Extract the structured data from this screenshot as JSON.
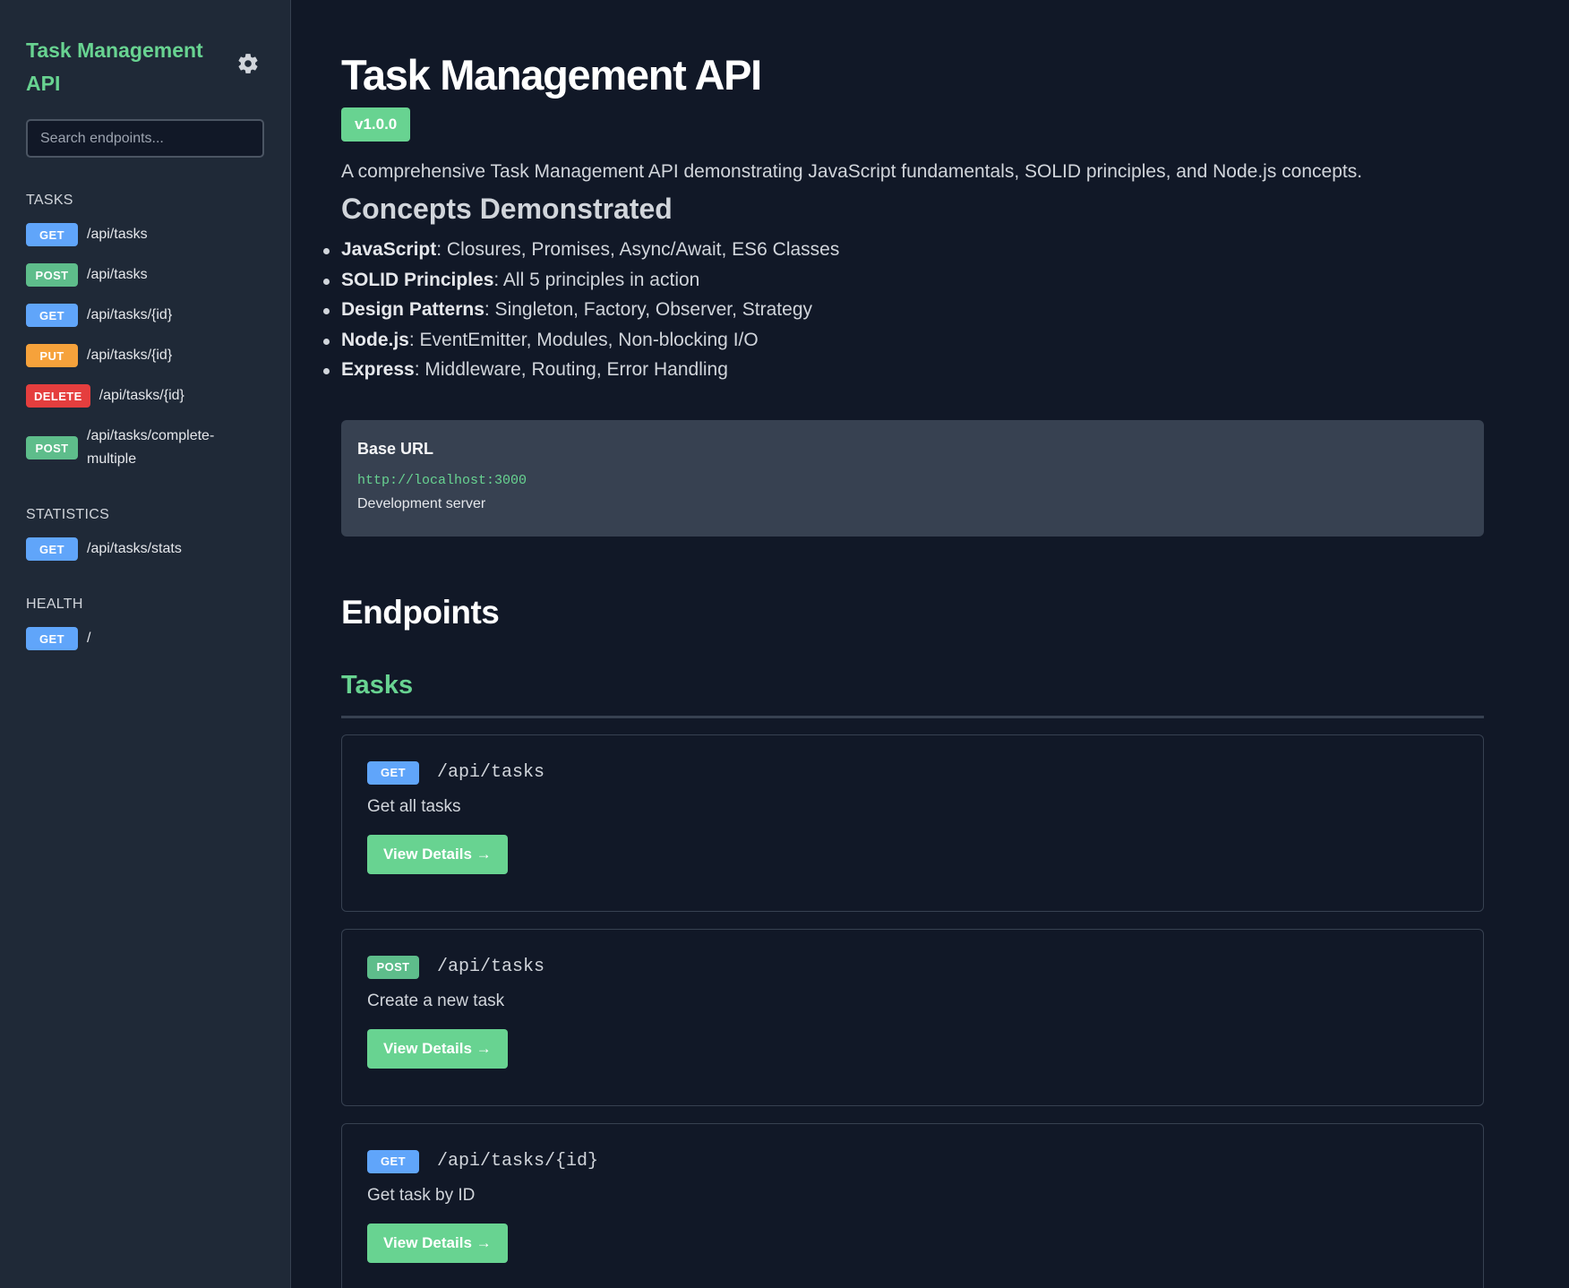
{
  "sidebar": {
    "title": "Task Management API",
    "settings_icon": "gear-icon",
    "search_placeholder": "Search endpoints...",
    "sections": [
      {
        "title": "TASKS",
        "items": [
          {
            "method": "GET",
            "path": "/api/tasks"
          },
          {
            "method": "POST",
            "path": "/api/tasks"
          },
          {
            "method": "GET",
            "path": "/api/tasks/{id}"
          },
          {
            "method": "PUT",
            "path": "/api/tasks/{id}"
          },
          {
            "method": "DELETE",
            "path": "/api/tasks/{id}"
          },
          {
            "method": "POST",
            "path": "/api/tasks/complete-multiple"
          }
        ]
      },
      {
        "title": "STATISTICS",
        "items": [
          {
            "method": "GET",
            "path": "/api/tasks/stats"
          }
        ]
      },
      {
        "title": "HEALTH",
        "items": [
          {
            "method": "GET",
            "path": "/"
          }
        ]
      }
    ]
  },
  "main": {
    "title": "Task Management API",
    "version": "v1.0.0",
    "description": "A comprehensive Task Management API demonstrating JavaScript fundamentals, SOLID principles, and Node.js concepts.",
    "concepts_title": "Concepts Demonstrated",
    "concepts": [
      {
        "term": "JavaScript",
        "text": ": Closures, Promises, Async/Await, ES6 Classes"
      },
      {
        "term": "SOLID Principles",
        "text": ": All 5 principles in action"
      },
      {
        "term": "Design Patterns",
        "text": ": Singleton, Factory, Observer, Strategy"
      },
      {
        "term": "Node.js",
        "text": ": EventEmitter, Modules, Non-blocking I/O"
      },
      {
        "term": "Express",
        "text": ": Middleware, Routing, Error Handling"
      }
    ],
    "base_url": {
      "title": "Base URL",
      "url": "http://localhost:3000",
      "note": "Development server"
    },
    "endpoints_title": "Endpoints",
    "group_title": "Tasks",
    "endpoints": [
      {
        "method": "GET",
        "path": "/api/tasks",
        "description": "Get all tasks",
        "button": "View Details →"
      },
      {
        "method": "POST",
        "path": "/api/tasks",
        "description": "Create a new task",
        "button": "View Details →"
      },
      {
        "method": "GET",
        "path": "/api/tasks/{id}",
        "description": "Get task by ID",
        "button": "View Details →"
      }
    ]
  },
  "colors": {
    "accent": "#68d391",
    "get": "#60a5fa",
    "post": "#5ebd8b",
    "put": "#f6a23b",
    "delete": "#e53e3e",
    "sidebar_bg": "#1f2937",
    "main_bg": "#111827"
  }
}
